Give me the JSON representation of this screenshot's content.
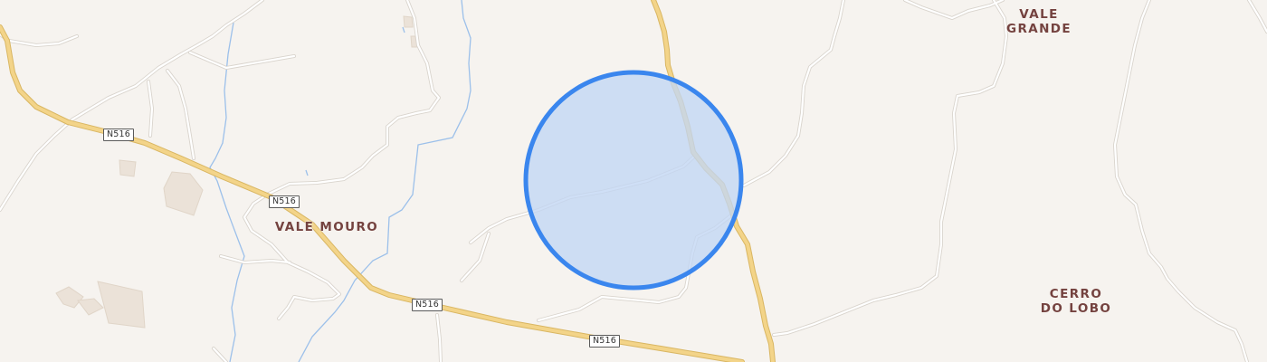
{
  "map": {
    "colors": {
      "background": "#f6f3ef",
      "minor_road": "#ffffff",
      "minor_road_casing": "#d9d4cd",
      "primary_road": "#f3d489",
      "primary_road_casing": "#d9b662",
      "stream": "#9cc0ea",
      "building": "#ebe2d8",
      "accuracy_fill": "#c2d6f3",
      "accuracy_stroke": "#3a86ee",
      "label": "#74423f"
    },
    "places": [
      {
        "name": "VALE GRANDE"
      },
      {
        "name": "VALE MOURO"
      },
      {
        "name": "CERRO\nDO LOBO"
      }
    ],
    "road_shields": [
      {
        "ref": "N516"
      },
      {
        "ref": "N516"
      },
      {
        "ref": "N516"
      },
      {
        "ref": "N516"
      }
    ],
    "location_marker": "location-accuracy-circle"
  }
}
